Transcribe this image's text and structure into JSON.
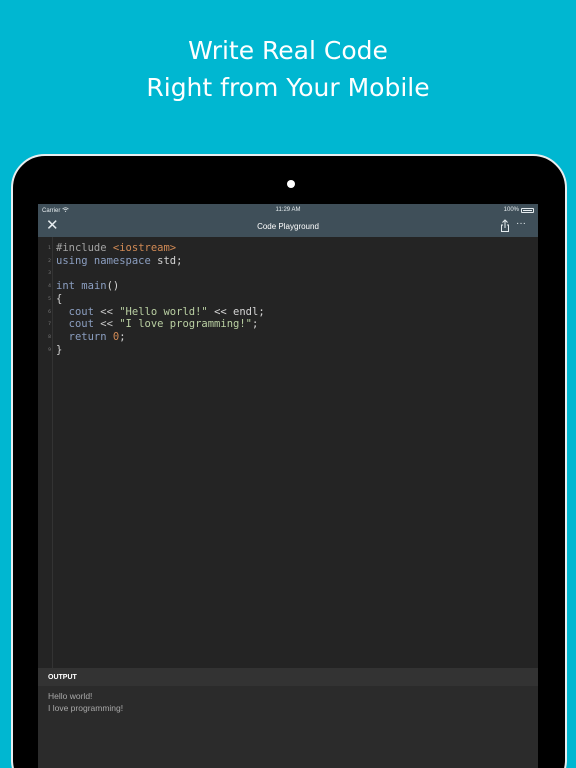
{
  "headline": {
    "line1": "Write Real Code",
    "line2": "Right from Your Mobile"
  },
  "colors": {
    "background": "#00b7d1",
    "navbar": "#3f4f59",
    "editor": "#242424",
    "output_header": "#333333",
    "string": "#b9cfa2",
    "number": "#d18a55",
    "keyword": "#8b9ec0"
  },
  "statusbar": {
    "carrier": "Carrier",
    "wifi_icon": "wifi-icon",
    "time": "11:29 AM",
    "battery": "100%",
    "battery_icon": "battery-icon"
  },
  "navbar": {
    "close_icon": "close-icon",
    "title": "Code Playground",
    "share_icon": "share-icon",
    "more_icon": "more-icon"
  },
  "editor": {
    "lines": [
      {
        "num": "1",
        "tokens": [
          {
            "text": "#include ",
            "type": "pre"
          },
          {
            "text": "<iostream>",
            "type": "inc"
          }
        ]
      },
      {
        "num": "2",
        "tokens": [
          {
            "text": "using namespace ",
            "type": "kw"
          },
          {
            "text": "std;",
            "type": "plain"
          }
        ]
      },
      {
        "num": "3",
        "tokens": []
      },
      {
        "num": "4",
        "tokens": [
          {
            "text": "int ",
            "type": "kw"
          },
          {
            "text": "main",
            "type": "fn"
          },
          {
            "text": "()",
            "type": "plain"
          }
        ]
      },
      {
        "num": "5",
        "tokens": [
          {
            "text": "{",
            "type": "plain"
          }
        ]
      },
      {
        "num": "6",
        "tokens": [
          {
            "text": "  cout ",
            "type": "kw"
          },
          {
            "text": "<< ",
            "type": "op"
          },
          {
            "text": "\"Hello world!\"",
            "type": "str"
          },
          {
            "text": " << endl;",
            "type": "plain"
          }
        ]
      },
      {
        "num": "7",
        "tokens": [
          {
            "text": "  cout ",
            "type": "kw"
          },
          {
            "text": "<< ",
            "type": "op"
          },
          {
            "text": "\"I love programming!\"",
            "type": "str"
          },
          {
            "text": ";",
            "type": "plain"
          }
        ]
      },
      {
        "num": "8",
        "tokens": [
          {
            "text": "  return ",
            "type": "kw"
          },
          {
            "text": "0",
            "type": "num"
          },
          {
            "text": ";",
            "type": "plain"
          }
        ]
      },
      {
        "num": "9",
        "tokens": [
          {
            "text": "}",
            "type": "plain"
          }
        ]
      }
    ]
  },
  "output": {
    "header": "OUTPUT",
    "lines": [
      "Hello world!",
      "I love programming!"
    ]
  }
}
